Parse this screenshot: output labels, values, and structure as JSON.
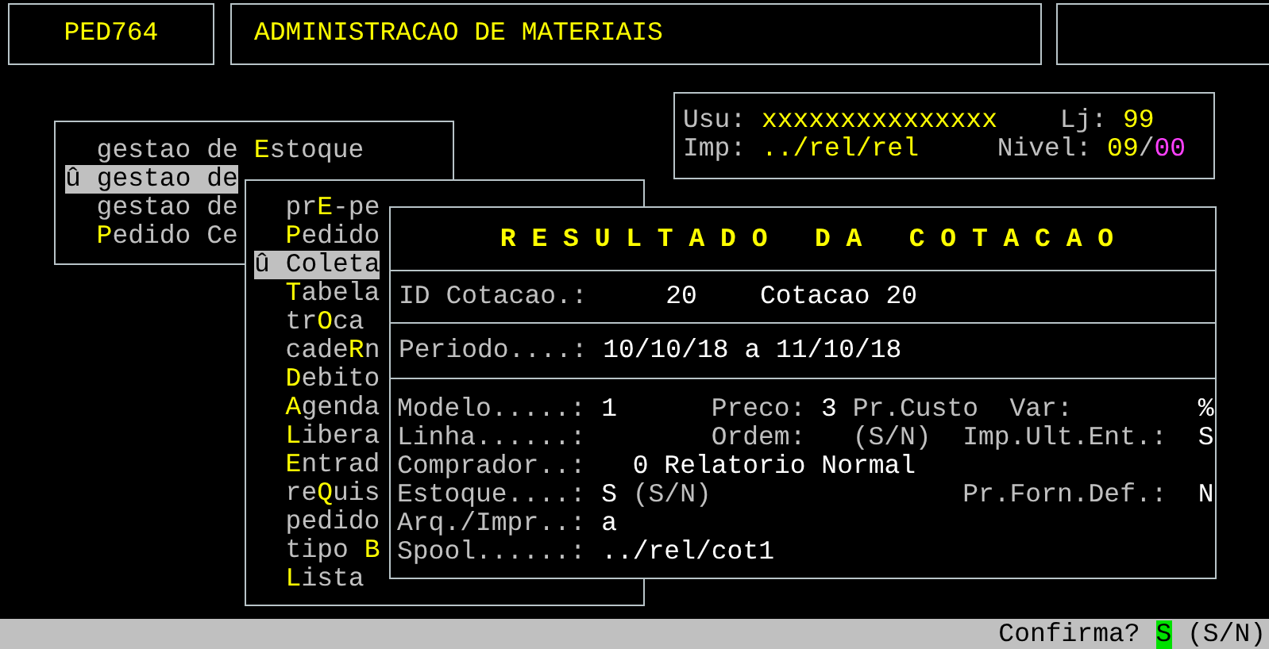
{
  "header": {
    "code": "PED764",
    "title": "ADMINISTRACAO DE MATERIAIS"
  },
  "session": {
    "lines": [
      [
        {
          "kind": "label",
          "text": "Usu:"
        },
        {
          "kind": "highlight",
          "text": "xxxxxxxxxxxxxxx"
        },
        {
          "kind": "label",
          "text": "Lj:"
        },
        {
          "kind": "highlight",
          "text": "99"
        }
      ],
      [
        {
          "kind": "label",
          "text": "Imp:"
        },
        {
          "kind": "highlight",
          "text": "../rel/rel"
        },
        {
          "kind": "label",
          "text": "Nivel:"
        },
        {
          "kind": "highlight",
          "text": "09"
        },
        {
          "kind": "label",
          "text": "/"
        },
        {
          "kind": "alert",
          "text": "00"
        }
      ]
    ]
  },
  "main_menu": {
    "marker": "û",
    "items": [
      {
        "parts": [
          {
            "kind": "plain",
            "text": "gestao de "
          },
          {
            "kind": "hotkey",
            "text": "E"
          },
          {
            "kind": "plain",
            "text": "stoque"
          }
        ],
        "selected": false
      },
      {
        "parts": [
          {
            "kind": "plain",
            "text": "gestao de"
          }
        ],
        "selected": true
      },
      {
        "parts": [
          {
            "kind": "plain",
            "text": "gestao de"
          }
        ],
        "selected": false
      },
      {
        "parts": [
          {
            "kind": "hotkey",
            "text": "P"
          },
          {
            "kind": "plain",
            "text": "edido Ce"
          }
        ],
        "selected": false
      }
    ]
  },
  "submenu": {
    "marker": "û",
    "items": [
      {
        "parts": [
          {
            "kind": "plain",
            "text": "pr"
          },
          {
            "kind": "hotkey",
            "text": "E"
          },
          {
            "kind": "plain",
            "text": "-pe"
          }
        ],
        "selected": false
      },
      {
        "parts": [
          {
            "kind": "hotkey",
            "text": "P"
          },
          {
            "kind": "plain",
            "text": "edido"
          }
        ],
        "selected": false
      },
      {
        "parts": [
          {
            "kind": "plain",
            "text": "Coleta"
          }
        ],
        "selected": true
      },
      {
        "parts": [
          {
            "kind": "hotkey",
            "text": "T"
          },
          {
            "kind": "plain",
            "text": "abela"
          }
        ],
        "selected": false
      },
      {
        "parts": [
          {
            "kind": "plain",
            "text": "tr"
          },
          {
            "kind": "hotkey",
            "text": "O"
          },
          {
            "kind": "plain",
            "text": "ca"
          }
        ],
        "selected": false
      },
      {
        "parts": [
          {
            "kind": "plain",
            "text": "cade"
          },
          {
            "kind": "hotkey",
            "text": "R"
          },
          {
            "kind": "plain",
            "text": "n"
          }
        ],
        "selected": false
      },
      {
        "parts": [
          {
            "kind": "hotkey",
            "text": "D"
          },
          {
            "kind": "plain",
            "text": "ebito"
          }
        ],
        "selected": false
      },
      {
        "parts": [
          {
            "kind": "hotkey",
            "text": "A"
          },
          {
            "kind": "plain",
            "text": "genda"
          }
        ],
        "selected": false
      },
      {
        "parts": [
          {
            "kind": "hotkey",
            "text": "L"
          },
          {
            "kind": "plain",
            "text": "ibera"
          }
        ],
        "selected": false
      },
      {
        "parts": [
          {
            "kind": "hotkey",
            "text": "E"
          },
          {
            "kind": "plain",
            "text": "ntrad"
          }
        ],
        "selected": false
      },
      {
        "parts": [
          {
            "kind": "plain",
            "text": "re"
          },
          {
            "kind": "hotkey",
            "text": "Q"
          },
          {
            "kind": "plain",
            "text": "uis"
          }
        ],
        "selected": false
      },
      {
        "parts": [
          {
            "kind": "plain",
            "text": "pedido"
          }
        ],
        "selected": false
      },
      {
        "parts": [
          {
            "kind": "plain",
            "text": "tipo "
          },
          {
            "kind": "hotkey",
            "text": "B"
          }
        ],
        "selected": false
      },
      {
        "parts": [
          {
            "kind": "hotkey",
            "text": "L"
          },
          {
            "kind": "plain",
            "text": "ista"
          }
        ],
        "selected": false
      }
    ]
  },
  "dialog": {
    "title": "R E S U L T A D O   D A   C O T A C A O",
    "sections": [
      [
        [
          {
            "kind": "label",
            "text": "ID Cotacao.:"
          },
          {
            "kind": "value",
            "text": "20"
          },
          {
            "kind": "value",
            "text": "Cotacao 20"
          }
        ]
      ],
      [
        [
          {
            "kind": "label",
            "text": "Periodo....:"
          },
          {
            "kind": "value",
            "text": "10/10/18 a 11/10/18"
          }
        ]
      ],
      [
        [
          {
            "kind": "label",
            "text": "Modelo.....:"
          },
          {
            "kind": "value",
            "text": "1"
          },
          {
            "kind": "label",
            "text": "Preco:"
          },
          {
            "kind": "value",
            "text": "3"
          },
          {
            "kind": "label",
            "text": "Pr.Custo"
          },
          {
            "kind": "label",
            "text": "Var:"
          },
          {
            "kind": "value",
            "text": "%"
          }
        ],
        [
          {
            "kind": "label",
            "text": "Linha......:"
          },
          {
            "kind": "label",
            "text": "Ordem:"
          },
          {
            "kind": "label",
            "text": "(S/N)"
          },
          {
            "kind": "label",
            "text": "Imp.Ult.Ent.:"
          },
          {
            "kind": "value",
            "text": "S"
          }
        ],
        [
          {
            "kind": "label",
            "text": "Comprador..:"
          },
          {
            "kind": "value",
            "text": "0 Relatorio Normal"
          }
        ],
        [
          {
            "kind": "label",
            "text": "Estoque....:"
          },
          {
            "kind": "value",
            "text": "S"
          },
          {
            "kind": "label",
            "text": "(S/N)"
          },
          {
            "kind": "label",
            "text": "Pr.Forn.Def.:"
          },
          {
            "kind": "value",
            "text": "N"
          }
        ],
        [
          {
            "kind": "label",
            "text": "Arq./Impr..:"
          },
          {
            "kind": "value",
            "text": "a"
          }
        ],
        [
          {
            "kind": "label",
            "text": "Spool......:"
          },
          {
            "kind": "value",
            "text": "../rel/cot1"
          }
        ]
      ]
    ]
  },
  "status_bar": {
    "prompt": "Confirma?",
    "answer": "S",
    "options": "(S/N)"
  }
}
